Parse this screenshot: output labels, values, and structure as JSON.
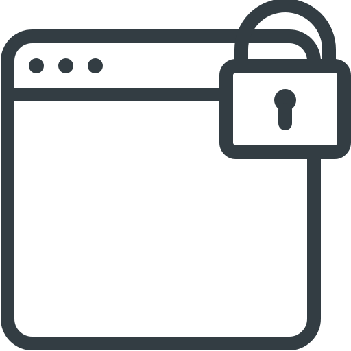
{
  "icon": {
    "name": "locked-browser-window-icon",
    "color": "#333d43",
    "background": "#ffffff"
  }
}
